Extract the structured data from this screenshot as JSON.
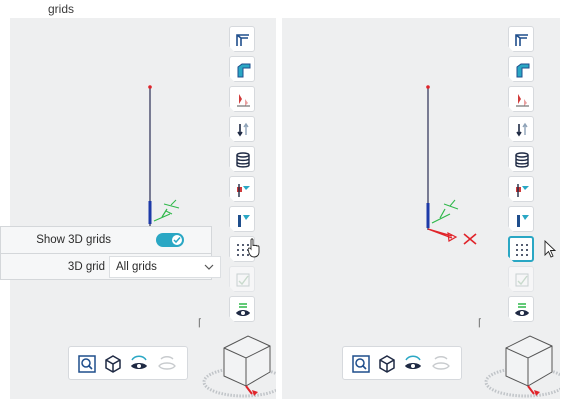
{
  "header": {
    "partial_text": "grids"
  },
  "grid_panel": {
    "show_3d_grids_label": "Show 3D grids",
    "show_3d_grids_on": true,
    "grid_select_label": "3D grid",
    "grid_select_value": "All grids"
  },
  "toolbar_icons": [
    "frame-icon",
    "profile-icon",
    "load-case-icon",
    "support-icon",
    "database-icon",
    "connection-icon",
    "member-icon",
    "3d-grid-icon",
    "check-icon",
    "visibility-icon"
  ],
  "bottom_icons": [
    "zoom-fit-icon",
    "cube-view-icon",
    "eye-rotate-icon",
    "eye-disabled-icon"
  ],
  "colors": {
    "accent": "#2aa7c4",
    "background": "#eeeff0",
    "axis_x": "#e0242a",
    "axis_y": "#2fb84a",
    "axis_z": "#1d3aa8"
  }
}
